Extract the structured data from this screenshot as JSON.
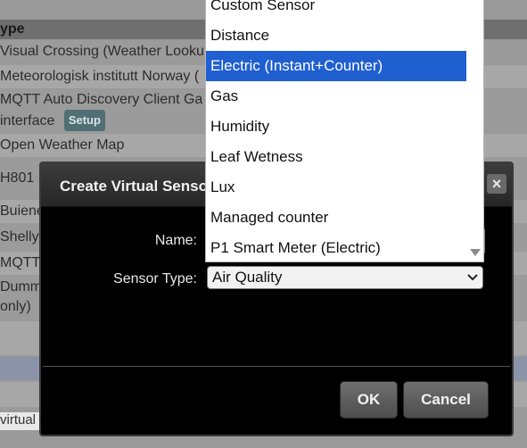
{
  "background": {
    "header": "ype",
    "rows": [
      {
        "text": "Visual Crossing (Weather Looku"
      },
      {
        "text": "Meteorologisk institutt Norway ("
      },
      {
        "text": "MQTT Auto Discovery Client Ga"
      },
      {
        "text": "interface",
        "badge": "Setup"
      },
      {
        "text": "Open Weather Map"
      },
      {
        "text": "H801"
      },
      {
        "text": "Buiene"
      },
      {
        "text": "Shelly"
      },
      {
        "text": "MQTT"
      },
      {
        "text": "Dumm"
      },
      {
        "text": "only)"
      }
    ],
    "bottom_input_value": "virtual"
  },
  "dialog": {
    "title": "Create Virtual Sensor",
    "close_label": "×",
    "name_label": "Name:",
    "name_value": "",
    "sensor_type_label": "Sensor Type:",
    "sensor_type_value": "Air Quality",
    "ok_label": "OK",
    "cancel_label": "Cancel"
  },
  "dropdown": {
    "options": [
      "Custom Sensor",
      "Distance",
      "Electric (Instant+Counter)",
      "Gas",
      "Humidity",
      "Leaf Wetness",
      "Lux",
      "Managed counter",
      "P1 Smart Meter (Electric)"
    ],
    "highlighted": "Electric (Instant+Counter)",
    "highlight_color": "#1f5fd0"
  }
}
